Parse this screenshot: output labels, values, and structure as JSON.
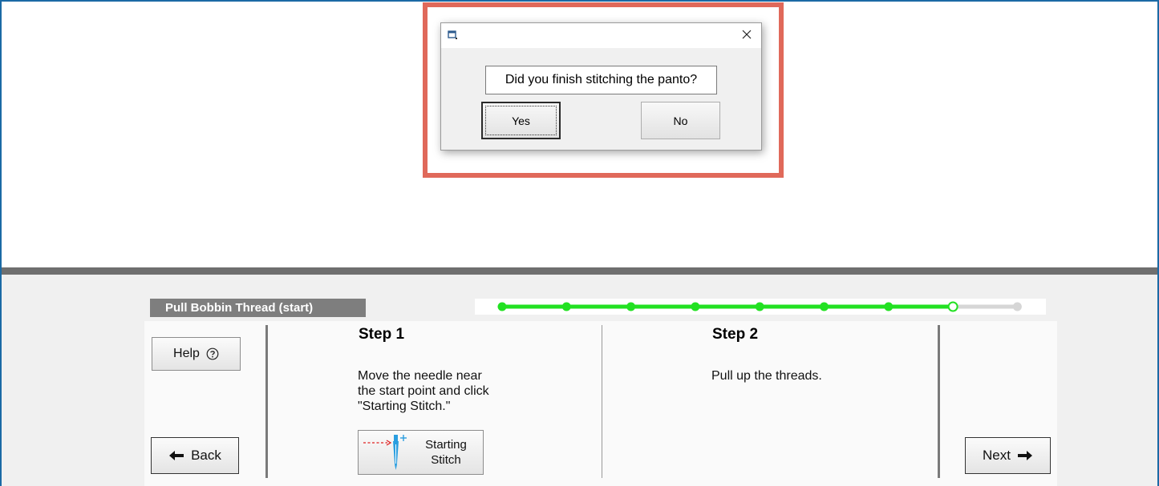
{
  "dialog": {
    "message": "Did you finish stitching the panto?",
    "yes_label": "Yes",
    "no_label": "No"
  },
  "wizard": {
    "stage_label": "Pull Bobbin Thread (start)",
    "progress": {
      "total_points": 9,
      "completed_points": 7,
      "current_point": 8
    },
    "step1": {
      "title": "Step 1",
      "text": "Move the needle near\nthe start point and click\n\"Starting Stitch.\"",
      "button_label": "Starting\nStitch"
    },
    "step2": {
      "title": "Step 2",
      "text": "Pull up the threads."
    },
    "help_label": "Help",
    "back_label": "Back",
    "next_label": "Next"
  },
  "colors": {
    "progress_done": "#22e122",
    "progress_pending": "#d6d6d6",
    "highlight": "#e0695a",
    "frame": "#1b6aa5"
  }
}
